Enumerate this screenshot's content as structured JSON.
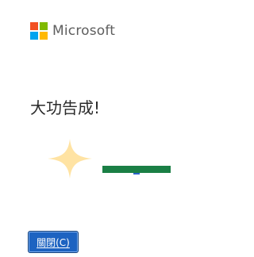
{
  "brand": {
    "name": "Microsoft",
    "logo_colors": [
      "#f25022",
      "#7fba00",
      "#00a4ef",
      "#ffb900"
    ]
  },
  "message": {
    "title": "大功告成!"
  },
  "sparkle": {
    "icon": "sparkle-icon",
    "color": "#ffe3a3"
  },
  "progress": {
    "value": 1.0,
    "fill_color": "#1a7f45",
    "marker_color": "#2b64c9"
  },
  "buttons": {
    "close_label": "關閉(C)",
    "bg_color": "#1d63c1"
  }
}
